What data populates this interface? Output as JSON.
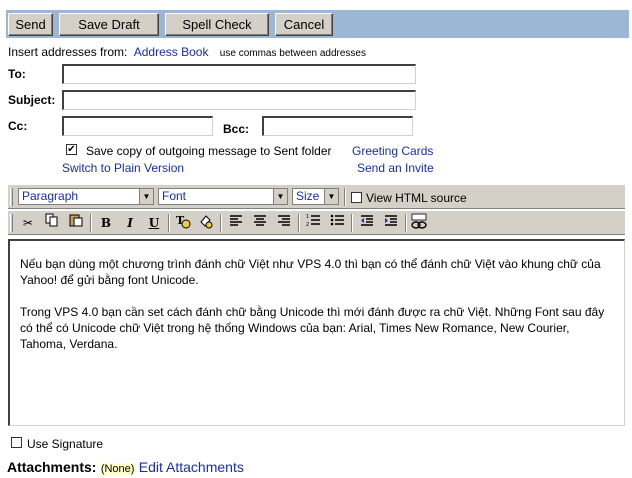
{
  "toolbar": {
    "send_label": "Send",
    "save_draft_label": "Save Draft",
    "spell_check_label": "Spell Check",
    "cancel_label": "Cancel"
  },
  "addresses": {
    "insert_from": "Insert addresses from:",
    "address_book": "Address Book",
    "hint": "use commas between addresses"
  },
  "fields": {
    "to_label": "To:",
    "to_value": "",
    "subject_label": "Subject:",
    "subject_value": "",
    "cc_label": "Cc:",
    "cc_value": "",
    "bcc_label": "Bcc:",
    "bcc_value": ""
  },
  "options": {
    "save_copy_label": "Save copy of outgoing message to Sent folder",
    "save_copy_checked": true,
    "greeting_cards": "Greeting Cards",
    "switch_plain": "Switch to Plain Version",
    "send_invite": "Send an Invite"
  },
  "format_bar": {
    "paragraph": "Paragraph",
    "font": "Font",
    "size": "Size",
    "view_html_label": "View HTML source",
    "view_html_checked": false
  },
  "format_buttons": {
    "bold": "B",
    "italic": "I",
    "underline": "U"
  },
  "editor": {
    "paragraphs": [
      "Nếu bạn dùng một chương trình đánh chữ Việt như VPS 4.0 thì bạn có thể đánh chữ Việt vào khung chữ của Yahoo! để gửi bằng font Unicode.",
      "Trong VPS 4.0 bạn cần set cách đánh chữ bằng Unicode thì mới đánh được ra chữ Việt. Những Font sau đây có thể có Unicode chữ Việt trong hệ thống Windows của bạn: Arial, Times New Romance, New Courier, Tahoma, Verdana."
    ]
  },
  "signature": {
    "label": "Use Signature",
    "checked": false
  },
  "attachments": {
    "label": "Attachments:",
    "status": "(None)",
    "edit": "Edit Attachments"
  }
}
